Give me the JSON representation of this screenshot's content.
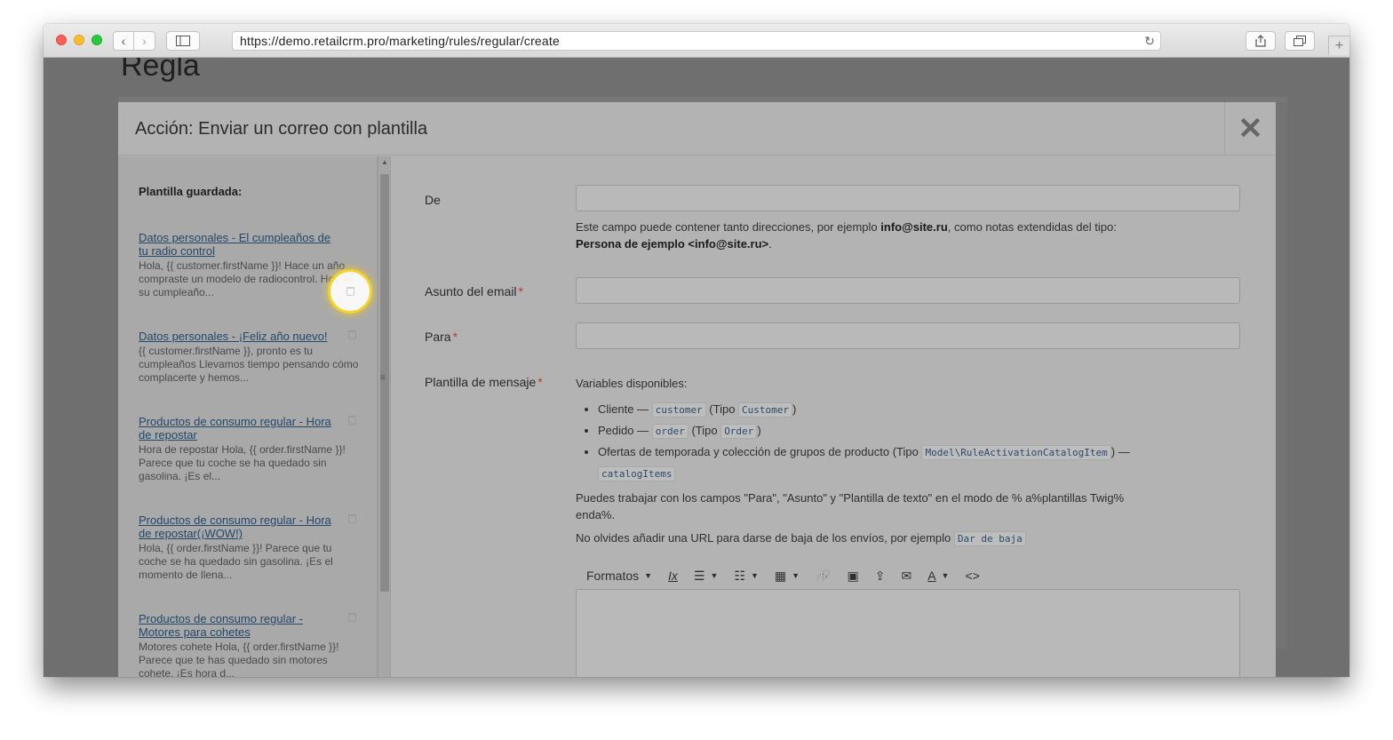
{
  "browser": {
    "url": "https://demo.retailcrm.pro/marketing/rules/regular/create",
    "back_icon": "‹",
    "forward_icon": "›",
    "reload_icon": "↻",
    "plus_icon": "+"
  },
  "page": {
    "title": "Regla"
  },
  "modal": {
    "title": "Acción: Enviar un correo con plantilla",
    "close_icon": "✕"
  },
  "sidebar": {
    "title": "Plantilla guardada:",
    "items": [
      {
        "title": "Datos personales - El cumpleaños de tu radio control",
        "desc": "Hola, {{ customer.firstName }}! Hace un año compraste un modelo de radiocontrol. Hoy es su cumpleaño..."
      },
      {
        "title": "Datos personales - ¡Feliz año nuevo!",
        "desc": "{{ customer.firstName }}, pronto es tu cumpleaños Llevamos tiempo pensando cómo complacerte y hemos..."
      },
      {
        "title": "Productos de consumo regular - Hora de repostar",
        "desc": "Hora de repostar Hola, {{ order.firstName }}! Parece que tu coche se ha quedado sin gasolina. ¡Es el..."
      },
      {
        "title": "Productos de consumo regular - Hora de repostar(¡WOW!)",
        "desc": "Hola, {{ order.firstName }}! Parece que tu coche se ha quedado sin gasolina. ¡Es el momento de llena..."
      },
      {
        "title": "Productos de consumo regular - Motores para cohetes",
        "desc": "Motores cohete Hola, {{ order.firstName }}! Parece que te has quedado sin motores cohete. ¡Es hora d..."
      }
    ]
  },
  "form": {
    "from_label": "De",
    "from_help_1": "Este campo puede contener tanto direcciones, por ejemplo ",
    "from_help_email": "info@site.ru",
    "from_help_2": ", como notas extendidas del tipo:",
    "from_help_example": "Persona de ejemplo <info@site.ru>",
    "from_help_end": ".",
    "subject_label": "Asunto del email",
    "to_label": "Para",
    "template_label": "Plantilla de mensaje",
    "required_mark": "*",
    "vars_title": "Variables disponibles:",
    "var_customer_label": "Cliente — ",
    "var_customer_code": "customer",
    "var_customer_type_pre": " (Tipo ",
    "var_customer_type": "Customer",
    "var_order_label": "Pedido — ",
    "var_order_code": "order",
    "var_order_type": "Order",
    "var_offers_label": "Ofertas de temporada y colección de grupos de producto (Tipo ",
    "var_offers_type": "Model\\RuleActivationCatalogItem",
    "var_offers_dash": ") — ",
    "var_offers_code": "catalogItems",
    "type_close": ")",
    "twig_note": "Puedes trabajar con los campos \"Para\", \"Asunto\" y \"Plantilla de texto\" en el modo de % a%plantillas Twig% enda%.",
    "unsubscribe_note": "No olvides añadir una URL para darse de baja de los envíos, por ejemplo ",
    "unsubscribe_code": "Dar de baja"
  },
  "editor_toolbar": {
    "formats_label": "Formatos",
    "caret": "▼",
    "clear_format_icon": "Ix",
    "bullet_list_icon": "☰",
    "numbered_list_icon": "☷",
    "table_icon": "▦",
    "link_icon": "🔗",
    "image_icon": "▣",
    "upload_icon": "⇪",
    "mail_icon": "✉",
    "text_color_icon": "A",
    "code_icon": "<>"
  }
}
